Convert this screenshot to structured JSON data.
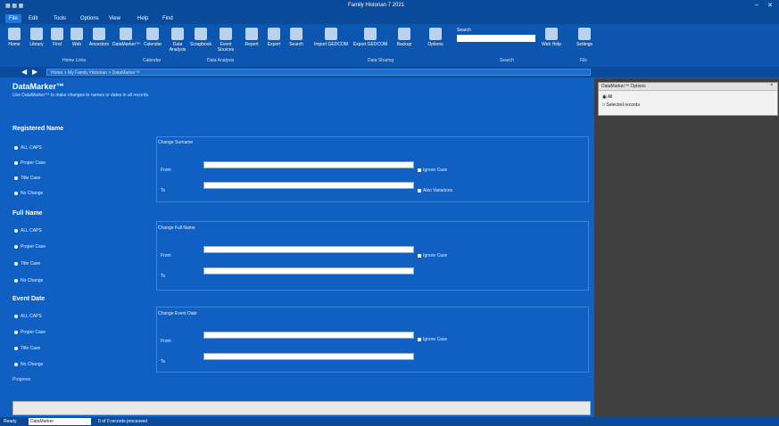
{
  "window": {
    "title": "Family Historian 7 2021"
  },
  "menu": {
    "tabs": [
      "File",
      "Edit",
      "Tools",
      "Options",
      "View",
      "Help",
      "Find"
    ]
  },
  "ribbon": {
    "buttons": [
      "Home",
      "Library",
      "Find",
      "Web",
      "Ancestors",
      "DataMarker™",
      "Calendar",
      "Data Analysis",
      "Scrapbook",
      "Event Sources",
      "Report",
      "Export",
      "Search",
      "Import GEDCOM",
      "Export GEDCOM",
      "Backup",
      "Options",
      "Web Help",
      "Settings"
    ],
    "groups": [
      "Home Links",
      "Calendar",
      "Data Analysis",
      "Data Sharing",
      "Search",
      "File"
    ],
    "search_label": "Search"
  },
  "path": {
    "text": "Home > My Family Historian > DataMarker™"
  },
  "page": {
    "title": "DataMarker™",
    "subtitle": "Use DataMarker™ to make changes to names or dates in all records."
  },
  "sections": [
    {
      "heading": "Registered Name",
      "group_title": "Change Surname",
      "radios": [
        "ALL CAPS",
        "Proper Case",
        "Title Case",
        "No Change"
      ],
      "fields": [
        "From",
        "To"
      ],
      "checks": [
        "Ignore Case",
        "Also Variations"
      ]
    },
    {
      "heading": "Full Name",
      "group_title": "Change Full Name",
      "radios": [
        "ALL CAPS",
        "Proper Case",
        "Title Case",
        "No Change"
      ],
      "fields": [
        "From",
        "To"
      ],
      "checks": [
        "Ignore Case"
      ]
    },
    {
      "heading": "Event Date",
      "group_title": "Change Event Date",
      "radios": [
        "ALL CAPS",
        "Proper Case",
        "Title Case",
        "No Change"
      ],
      "fields": [
        "From",
        "To"
      ],
      "checks": [
        "Ignore Case"
      ]
    }
  ],
  "progress_label": "Progress",
  "side": {
    "title": "DataMarker™ Options",
    "items": [
      "All",
      "Selected records"
    ]
  },
  "status": {
    "left": "Ready",
    "input": "DataMarker",
    "message": "0 of 0 records processed"
  }
}
